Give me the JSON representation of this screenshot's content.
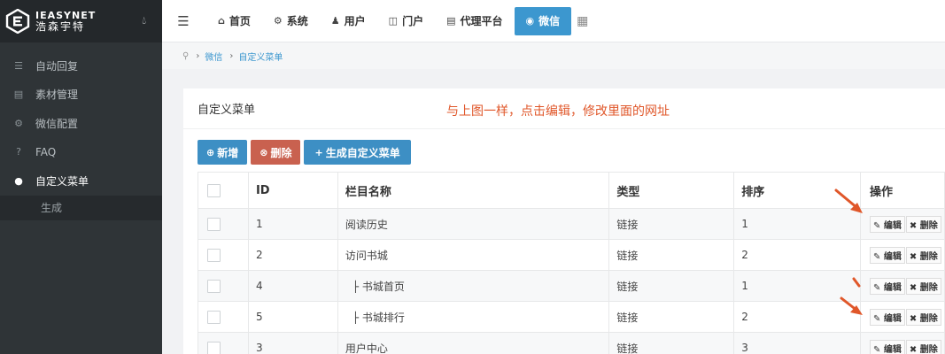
{
  "brand": {
    "name_en": "IEASYNET",
    "name_cn": "浩森宇特",
    "drop_icon": "droplet-icon"
  },
  "sidebar": {
    "items": [
      {
        "label": "自动回复",
        "icon": "list-icon"
      },
      {
        "label": "素材管理",
        "icon": "file-icon"
      },
      {
        "label": "微信配置",
        "icon": "cogs-icon"
      },
      {
        "label": "FAQ",
        "icon": "question-icon"
      },
      {
        "label": "自定义菜单",
        "icon": "user-circle-icon",
        "active": true
      }
    ],
    "sub_item": "生成"
  },
  "topnav": {
    "items": [
      {
        "label": "首页",
        "icon": "home-icon"
      },
      {
        "label": "系统",
        "icon": "gear-icon"
      },
      {
        "label": "用户",
        "icon": "user-icon"
      },
      {
        "label": "门户",
        "icon": "portal-icon"
      },
      {
        "label": "代理平台",
        "icon": "agent-icon"
      },
      {
        "label": "微信",
        "icon": "wechat-icon",
        "active": true
      }
    ]
  },
  "breadcrumb": {
    "items": [
      "微信",
      "自定义菜单"
    ]
  },
  "panel": {
    "title": "自定义菜单",
    "annotation": "与上图一样，点击编辑，修改里面的网址"
  },
  "toolbar": {
    "add_label": "新增",
    "delete_label": "删除",
    "generate_label": "生成自定义菜单"
  },
  "table": {
    "headers": {
      "id": "ID",
      "name": "栏目名称",
      "type": "类型",
      "sort": "排序",
      "action": "操作"
    },
    "edit_label": "编辑",
    "delete_label": "删除",
    "rows": [
      {
        "id": "1",
        "name": "阅读历史",
        "type": "链接",
        "sort": "1"
      },
      {
        "id": "2",
        "name": "访问书城",
        "type": "链接",
        "sort": "2"
      },
      {
        "id": "4",
        "name": "├ 书城首页",
        "type": "链接",
        "sort": "1"
      },
      {
        "id": "5",
        "name": "├ 书城排行",
        "type": "链接",
        "sort": "2"
      },
      {
        "id": "3",
        "name": "用户中心",
        "type": "链接",
        "sort": "3"
      }
    ]
  },
  "colors": {
    "accent": "#3c97cf",
    "danger": "#c9614f",
    "sidebar": "#2f3437",
    "annotation": "#e0572a"
  }
}
